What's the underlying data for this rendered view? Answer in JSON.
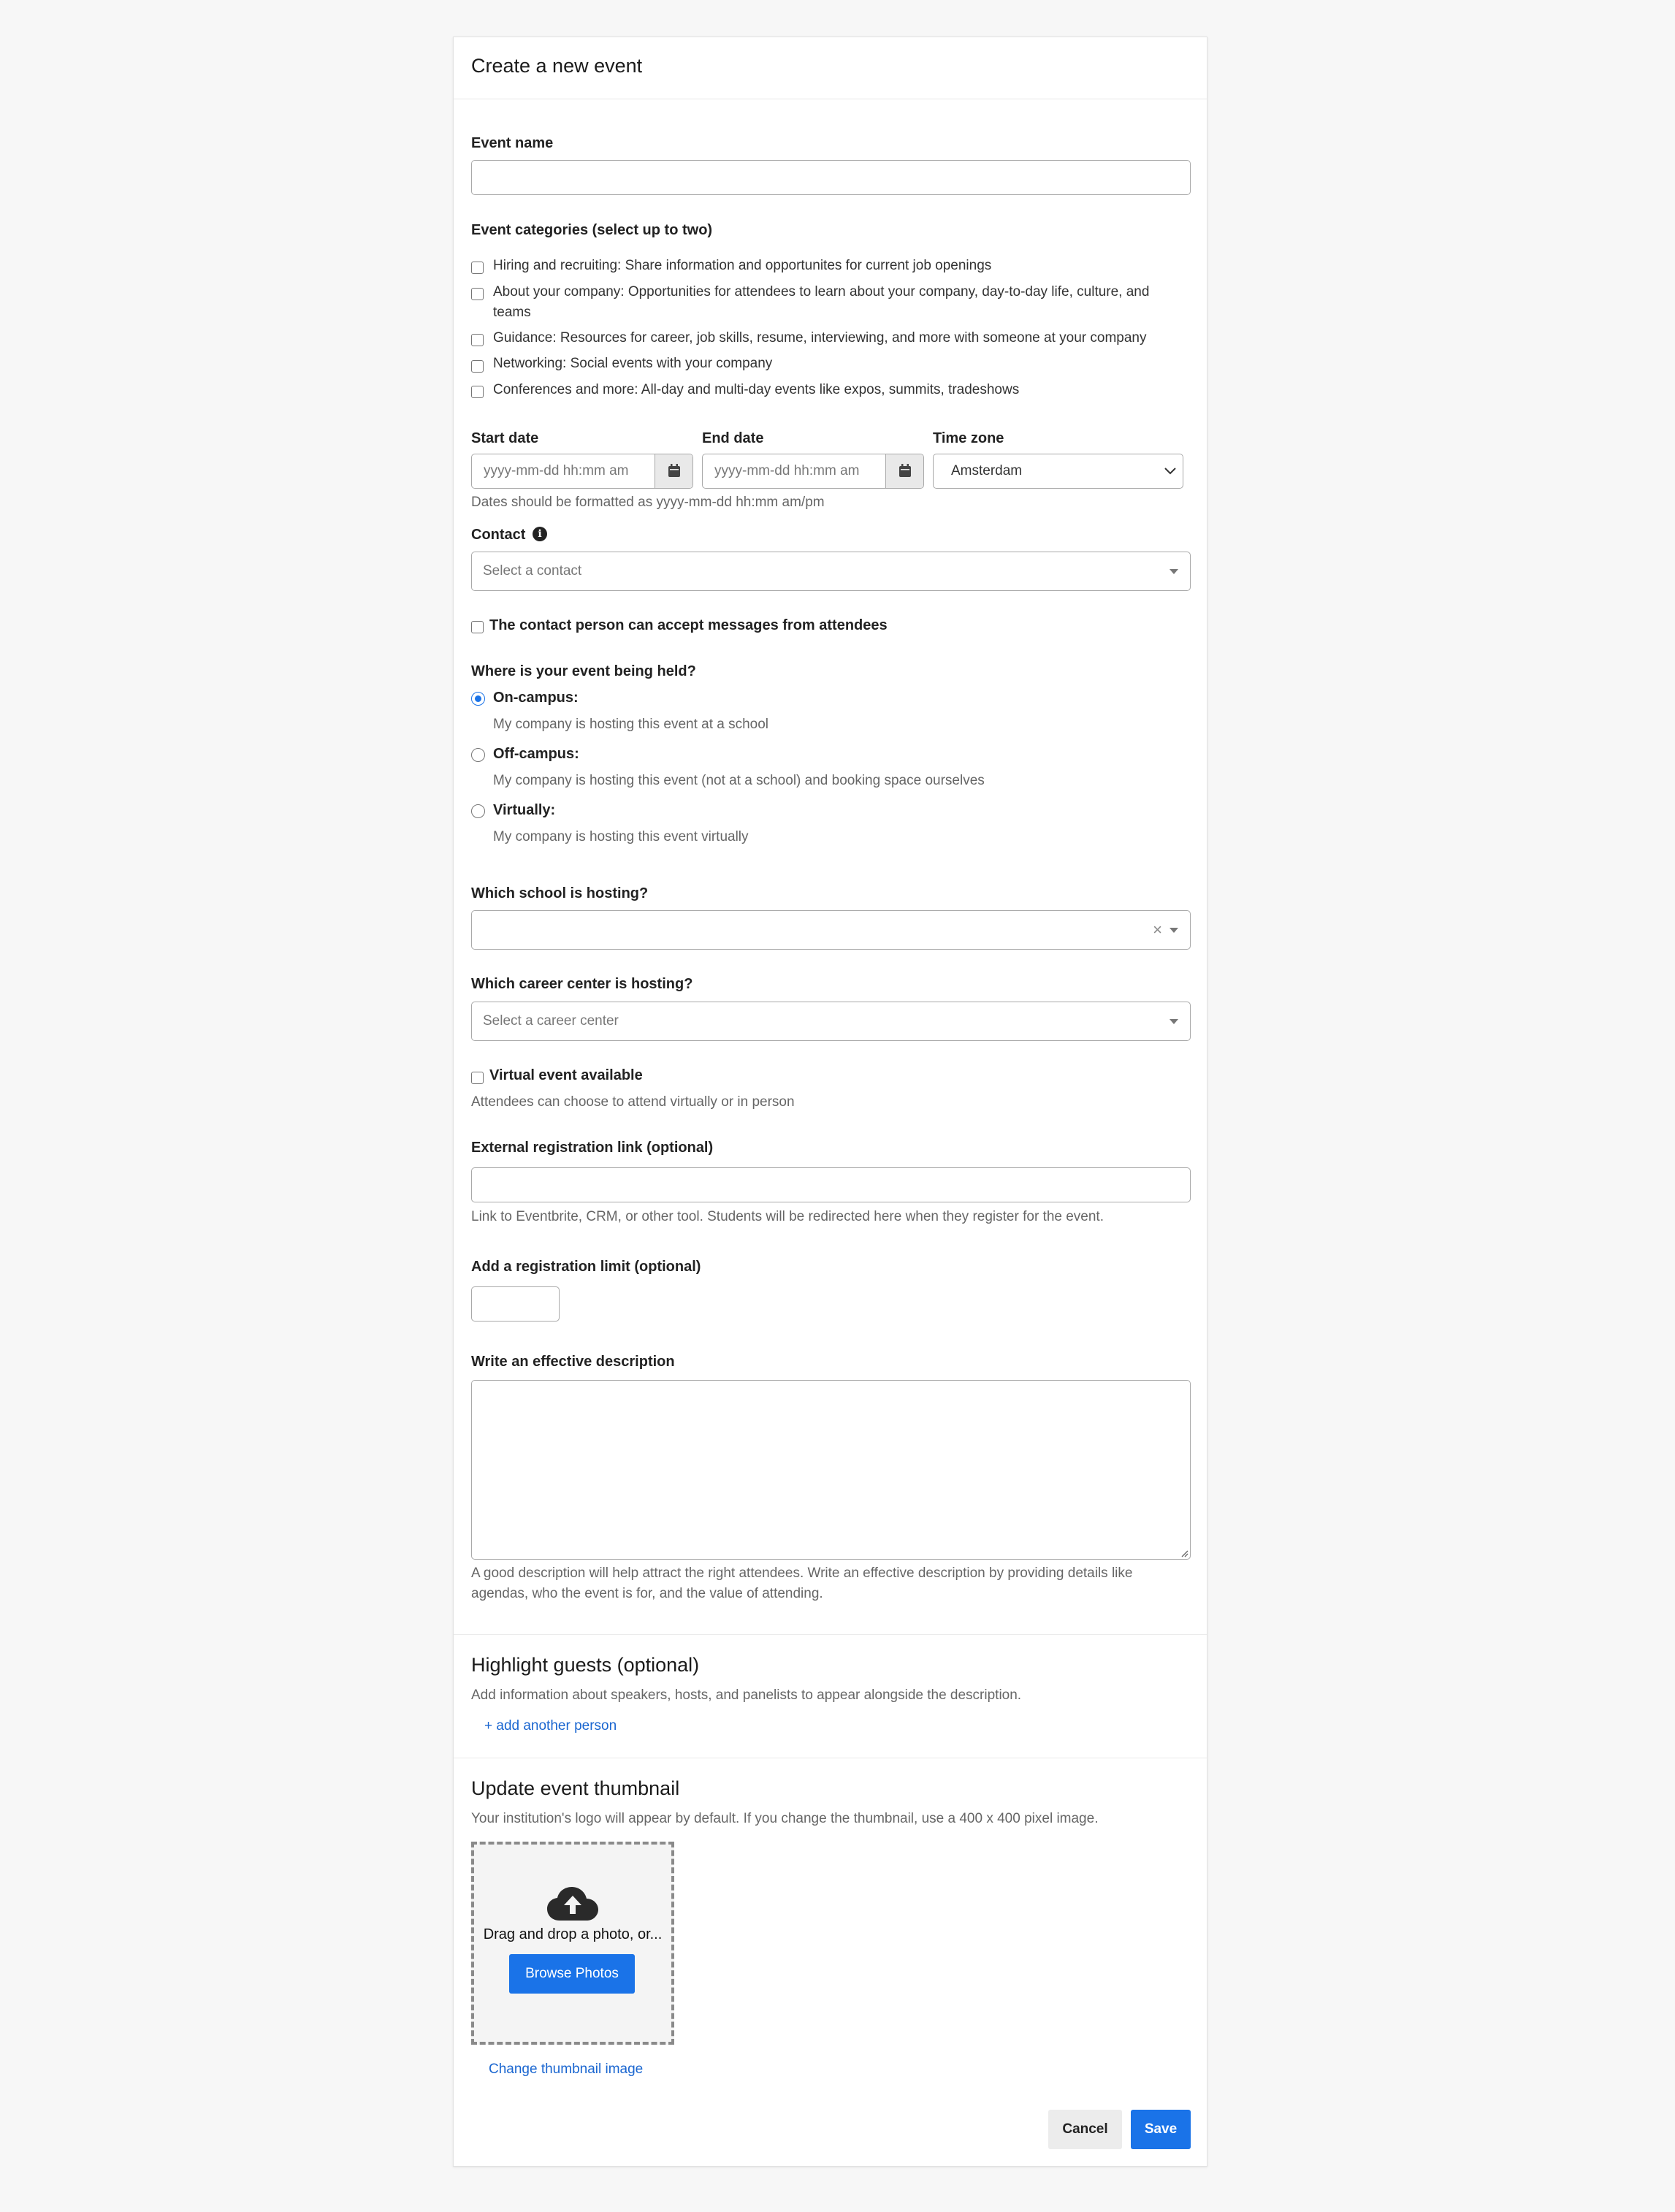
{
  "header": {
    "title": "Create a new event"
  },
  "event_name": {
    "label": "Event name",
    "value": ""
  },
  "categories": {
    "label": "Event categories (select up to two)",
    "items": [
      {
        "text": "Hiring and recruiting: Share information and opportunites for current job openings",
        "checked": false
      },
      {
        "text": "About your company: Opportunities for attendees to learn about your company, day-to-day life, culture, and",
        "text2": "teams",
        "checked": false
      },
      {
        "text": "Guidance: Resources for career, job skills, resume, interviewing, and more with someone at your company",
        "checked": false
      },
      {
        "text": "Networking: Social events with your company",
        "checked": false
      },
      {
        "text": "Conferences and more: All-day and multi-day events like expos, summits, tradeshows",
        "checked": false
      }
    ]
  },
  "dates": {
    "start_label": "Start date",
    "end_label": "End date",
    "timezone_label": "Time zone",
    "start_placeholder": "yyyy-mm-dd hh:mm am",
    "end_placeholder": "yyyy-mm-dd hh:mm am",
    "timezone_value": "Amsterdam",
    "help": "Dates should be formatted as yyyy-mm-dd hh:mm am/pm"
  },
  "contact": {
    "label": "Contact",
    "placeholder": "Select a contact",
    "accept_messages_label": "The contact person can accept messages from attendees"
  },
  "location": {
    "label": "Where is your event being held?",
    "options": [
      {
        "title": "On-campus:",
        "desc": "My company is hosting this event at a school",
        "selected": true
      },
      {
        "title": "Off-campus:",
        "desc": "My company is hosting this event (not at a school) and booking space ourselves",
        "selected": false
      },
      {
        "title": "Virtually:",
        "desc": "My company is hosting this event virtually",
        "selected": false
      }
    ]
  },
  "school": {
    "label": "Which school is hosting?",
    "value": ""
  },
  "career_center": {
    "label": "Which career center is hosting?",
    "placeholder": "Select a career center"
  },
  "virtual": {
    "label": "Virtual event available",
    "help": "Attendees can choose to attend virtually or in person"
  },
  "registration_link": {
    "label": "External registration link (optional)",
    "help": "Link to Eventbrite, CRM, or other tool. Students will be redirected here when they register for the event."
  },
  "registration_limit": {
    "label": "Add a registration limit (optional)"
  },
  "description": {
    "label": "Write an effective description",
    "help_line1": "A good description will help attract the right attendees. Write an effective description by providing details like",
    "help_line2": "agendas, who the event is for, and the value of attending."
  },
  "guests": {
    "title": "Highlight guests (optional)",
    "help": "Add information about speakers, hosts, and panelists to appear alongside the description.",
    "add_link": "+ add another person"
  },
  "thumbnail": {
    "title": "Update event thumbnail",
    "help": "Your institution's logo will appear by default. If you change the thumbnail, use a 400 x 400 pixel image.",
    "drop_text": "Drag and drop a photo, or...",
    "browse_label": "Browse Photos",
    "change_link": "Change thumbnail image"
  },
  "footer": {
    "cancel_label": "Cancel",
    "save_label": "Save"
  },
  "colors": {
    "accent": "#1a73e8",
    "link": "#1a66d0",
    "background": "#f7f7f7"
  }
}
